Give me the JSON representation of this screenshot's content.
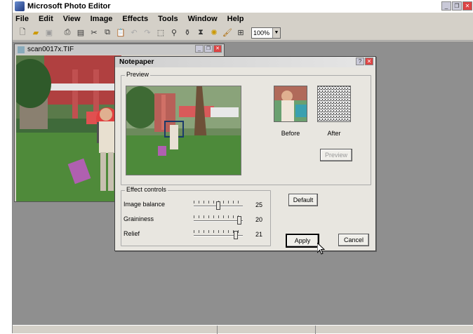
{
  "app": {
    "title": "Microsoft Photo Editor",
    "menu": [
      "File",
      "Edit",
      "View",
      "Image",
      "Effects",
      "Tools",
      "Window",
      "Help"
    ],
    "toolbar_icons": [
      "new-icon",
      "open-icon",
      "save-icon",
      "print-icon",
      "scan-icon",
      "cut-icon",
      "copy-icon",
      "paste-icon",
      "undo-icon",
      "redo-icon",
      "select-icon",
      "zoom-icon",
      "stamp-icon",
      "filter-icon",
      "effects-icon",
      "brush-icon",
      "resize-icon"
    ],
    "zoom": "100%"
  },
  "document": {
    "filename": "scan0017x.TIF"
  },
  "dialog": {
    "title": "Notepaper",
    "preview_group": "Preview",
    "before_label": "Before",
    "after_label": "After",
    "preview_button": "Preview",
    "effect_group": "Effect controls",
    "controls": [
      {
        "label": "Image balance",
        "value": "25",
        "level": 0.5
      },
      {
        "label": "Graininess",
        "value": "20",
        "level": 0.93
      },
      {
        "label": "Relief",
        "value": "21",
        "level": 0.85
      }
    ],
    "default_button": "Default",
    "apply_button": "Apply",
    "cancel_button": "Cancel"
  },
  "colors": {
    "chrome": "#d4d0c8",
    "workspace": "#8f8f8f",
    "dialog_bg": "#e8e6e0"
  }
}
